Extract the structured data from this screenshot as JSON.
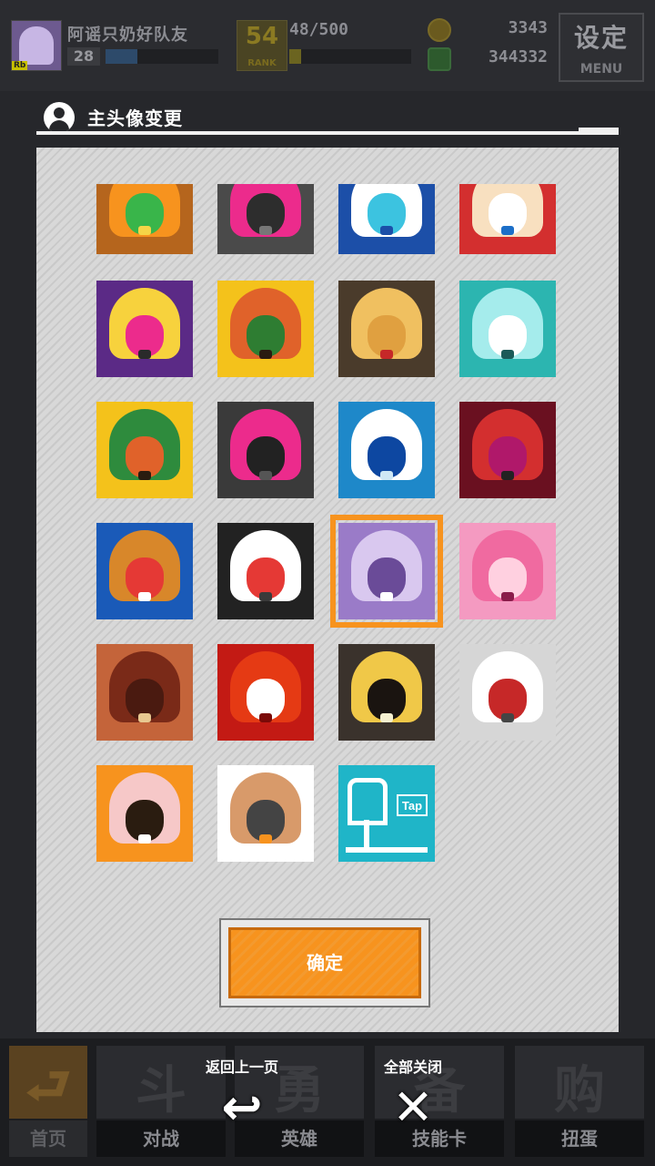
{
  "player": {
    "name": "阿谣只奶好队友",
    "level": "28",
    "level_badge": "Rb",
    "exp_progress": 0.28
  },
  "rank": {
    "value": "54",
    "label": "RANK"
  },
  "stamina": {
    "text": "48/500",
    "progress": 0.1
  },
  "currency": {
    "coins": "3343",
    "gems": "344332"
  },
  "settings": {
    "main_label": "设定",
    "sub_label": "MENU"
  },
  "dialog": {
    "title": "主头像变更",
    "confirm_label": "确定"
  },
  "avatars": [
    {
      "name": "avatar-orange-green",
      "bg": "#b5651d",
      "c1": "#f7931e",
      "c2": "#39b54a",
      "c3": "#f5d547"
    },
    {
      "name": "avatar-gray-pink",
      "bg": "#4a4a4a",
      "c1": "#ec2b8c",
      "c2": "#2d2d2d",
      "c3": "#777"
    },
    {
      "name": "avatar-blue-white",
      "bg": "#1c4fa8",
      "c1": "#ffffff",
      "c2": "#3cc3e0",
      "c3": "#1c4fa8"
    },
    {
      "name": "avatar-red-white",
      "bg": "#d32f2f",
      "c1": "#f8e0c0",
      "c2": "#ffffff",
      "c3": "#1c6fc8"
    },
    {
      "name": "avatar-purple-yellow",
      "bg": "#5b2a86",
      "c1": "#f7d23d",
      "c2": "#ec2b8c",
      "c3": "#2a2a2a"
    },
    {
      "name": "avatar-yellow-orange",
      "bg": "#f4c21b",
      "c1": "#e0622a",
      "c2": "#2e7d32",
      "c3": "#2a1c10"
    },
    {
      "name": "avatar-brown-blonde",
      "bg": "#4a3b2b",
      "c1": "#f0c060",
      "c2": "#e0a040",
      "c3": "#c62828"
    },
    {
      "name": "avatar-teal-white",
      "bg": "#2cb5b0",
      "c1": "#a5ecec",
      "c2": "#ffffff",
      "c3": "#1b5a58"
    },
    {
      "name": "avatar-yellow-green-hat",
      "bg": "#f4c21b",
      "c1": "#2e8b3d",
      "c2": "#e0622a",
      "c3": "#2a1c10"
    },
    {
      "name": "avatar-dark-pink",
      "bg": "#3a3a3a",
      "c1": "#ec2b8c",
      "c2": "#222",
      "c3": "#555"
    },
    {
      "name": "avatar-blue-white-hair",
      "bg": "#1e88c9",
      "c1": "#ffffff",
      "c2": "#0d47a1",
      "c3": "#cfe8f5"
    },
    {
      "name": "avatar-crimson",
      "bg": "#6a1020",
      "c1": "#d32f2f",
      "c2": "#b0186a",
      "c3": "#222"
    },
    {
      "name": "avatar-pixel-crown",
      "bg": "#1a5ab8",
      "c1": "#d8872a",
      "c2": "#e53935",
      "c3": "#ffffff"
    },
    {
      "name": "avatar-black-hood",
      "bg": "#222222",
      "c1": "#ffffff",
      "c2": "#e53935",
      "c3": "#3a3a3a"
    },
    {
      "name": "avatar-purple-maid",
      "bg": "#9a7bc8",
      "c1": "#d9c8ef",
      "c2": "#6a4b98",
      "c3": "#ffffff"
    },
    {
      "name": "avatar-pink-hair",
      "bg": "#f49ac1",
      "c1": "#f06aa0",
      "c2": "#ffd0e0",
      "c3": "#8a1c4a"
    },
    {
      "name": "avatar-brown-spiky",
      "bg": "#c4643a",
      "c1": "#7a2a18",
      "c2": "#4a1a10",
      "c3": "#e8c890"
    },
    {
      "name": "avatar-red-eye",
      "bg": "#c31a14",
      "c1": "#e53a14",
      "c2": "#ffffff",
      "c3": "#7a0a08"
    },
    {
      "name": "avatar-dark-blonde",
      "bg": "#3a322c",
      "c1": "#f0c848",
      "c2": "#1a1410",
      "c3": "#f5f0d0"
    },
    {
      "name": "avatar-white-officer",
      "bg": "#d6d6d6",
      "c1": "#ffffff",
      "c2": "#c62828",
      "c3": "#444"
    },
    {
      "name": "avatar-orange-catgirl",
      "bg": "#f7931e",
      "c1": "#f6c8c8",
      "c2": "#2a1c10",
      "c3": "#ffffff"
    },
    {
      "name": "avatar-box",
      "bg": "#ffffff",
      "c1": "#d89a6a",
      "c2": "#444444",
      "c3": "#f7931e"
    },
    {
      "name": "avatar-tap",
      "bg": "#1fb5c8",
      "c1": "#ffffff",
      "c2": "#1fb5c8",
      "c3": "#ffffff",
      "text": "Tap"
    }
  ],
  "selected_index": 14,
  "bottom_nav": [
    {
      "label": "首页",
      "glyph": "⮐",
      "icon": "home-icon"
    },
    {
      "label": "对战",
      "glyph": "斗",
      "icon": "gamepad-icon"
    },
    {
      "label": "英雄",
      "glyph": "勇",
      "icon": "hero-icon"
    },
    {
      "label": "技能卡",
      "glyph": "备",
      "icon": "skill-card-icon"
    },
    {
      "label": "扭蛋",
      "glyph": "购",
      "icon": "gacha-icon"
    }
  ],
  "float_actions": [
    {
      "label": "返回上一页",
      "glyph": "↩",
      "icon": "back-icon"
    },
    {
      "label": "全部关闭",
      "glyph": "✕",
      "icon": "close-all-icon"
    }
  ]
}
